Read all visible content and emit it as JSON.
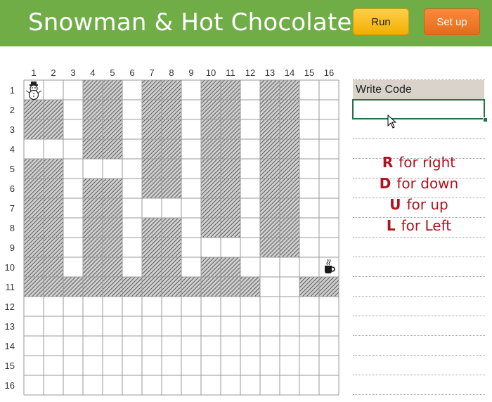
{
  "header": {
    "title": "Snowman & Hot Chocolate",
    "run_label": "Run",
    "setup_label": "Set up",
    "bg_color": "#70ad47"
  },
  "grid": {
    "columns": [
      "1",
      "2",
      "3",
      "4",
      "5",
      "6",
      "7",
      "8",
      "9",
      "10",
      "11",
      "12",
      "13",
      "14",
      "15",
      "16"
    ],
    "rows": [
      "1",
      "2",
      "3",
      "4",
      "5",
      "6",
      "7",
      "8",
      "9",
      "10",
      "11",
      "12",
      "13",
      "14",
      "15",
      "16"
    ],
    "walls": {
      "1": [
        4,
        5,
        7,
        8,
        10,
        11,
        13,
        14
      ],
      "2": [
        1,
        2,
        4,
        5,
        7,
        8,
        10,
        11,
        13,
        14
      ],
      "3": [
        1,
        2,
        4,
        5,
        7,
        8,
        10,
        11,
        13,
        14
      ],
      "4": [
        4,
        5,
        7,
        8,
        10,
        11,
        13,
        14
      ],
      "5": [
        1,
        2,
        7,
        8,
        10,
        11,
        13,
        14
      ],
      "6": [
        1,
        2,
        4,
        5,
        7,
        8,
        10,
        11,
        13,
        14
      ],
      "7": [
        1,
        2,
        4,
        5,
        10,
        11,
        13,
        14
      ],
      "8": [
        1,
        2,
        4,
        5,
        7,
        8,
        10,
        11,
        13,
        14
      ],
      "9": [
        1,
        2,
        4,
        5,
        7,
        8,
        13,
        14
      ],
      "10": [
        1,
        2,
        4,
        5,
        7,
        8,
        10,
        11
      ],
      "11": [
        1,
        2,
        3,
        4,
        5,
        6,
        7,
        8,
        9,
        10,
        11,
        12,
        15,
        16
      ]
    },
    "snowman": {
      "row": 1,
      "col": 1,
      "icon": "snowman-icon"
    },
    "cocoa": {
      "row": 10,
      "col": 16,
      "icon": "hot-chocolate-icon"
    }
  },
  "code_panel": {
    "header": "Write Code",
    "value": ""
  },
  "legend": [
    {
      "key": "R",
      "text": "for right"
    },
    {
      "key": "D",
      "text": "for down"
    },
    {
      "key": "U",
      "text": "for up"
    },
    {
      "key": "L",
      "text": "for Left"
    }
  ]
}
